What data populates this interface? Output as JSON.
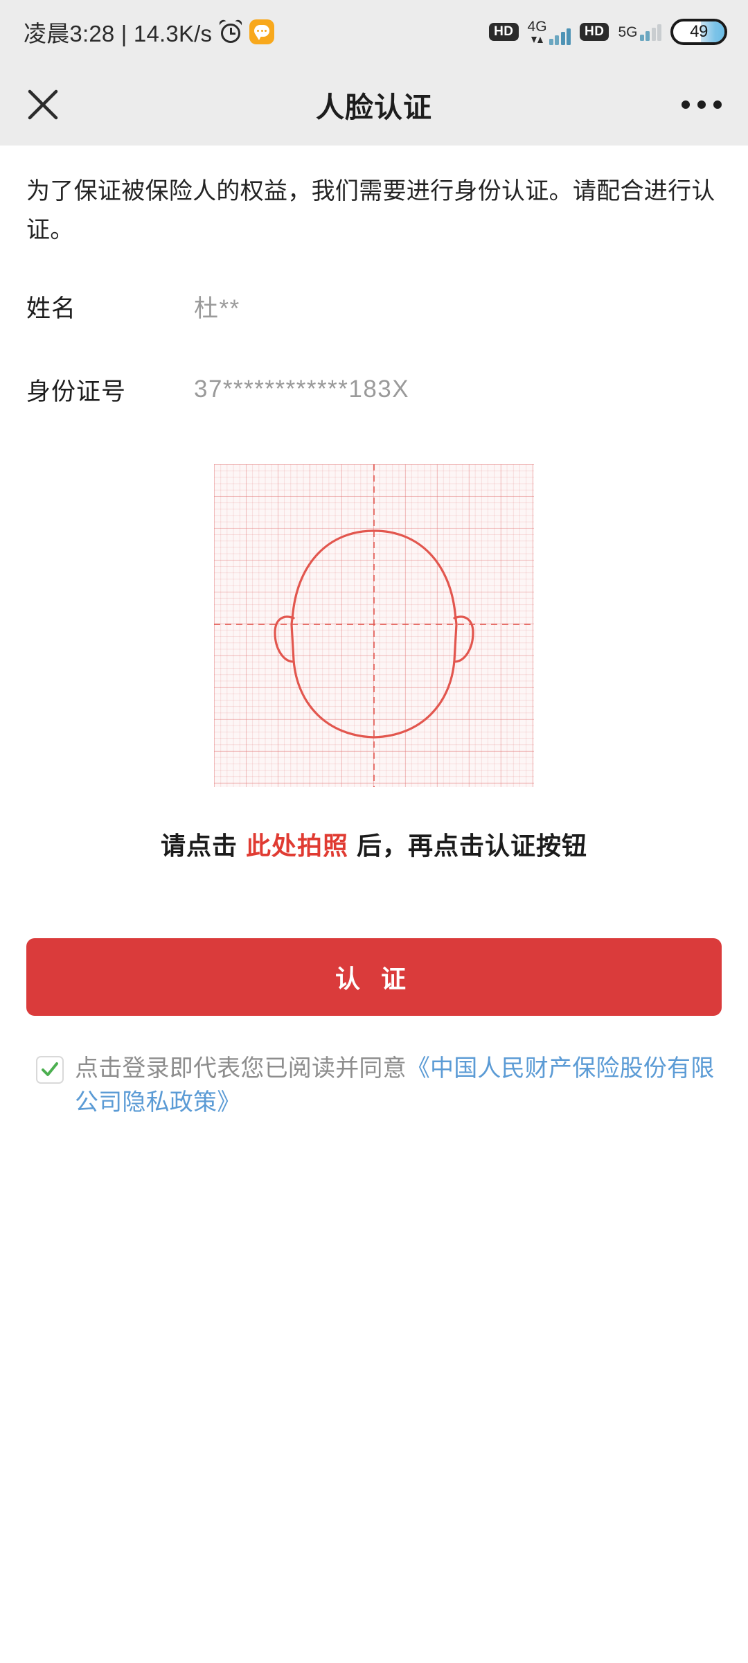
{
  "statusbar": {
    "clock": "凌晨3:28 | 14.3K/s",
    "alarm_icon": "alarm-clock-icon",
    "message_icon": "message-bubble-icon",
    "hd_badge_1": "HD",
    "network_1": "4G",
    "hd_badge_2": "HD",
    "network_2": "5G",
    "battery_level": "49"
  },
  "header": {
    "close_icon": "close-icon",
    "title": "人脸认证",
    "more_icon": "more-options-icon"
  },
  "main": {
    "description": "为了保证被保险人的权益，我们需要进行身份认证。请配合进行认证。",
    "fields": [
      {
        "label": "姓名",
        "value": "杜**"
      },
      {
        "label": "身份证号",
        "value": "37************183X"
      }
    ],
    "face_frame": {
      "name": "face-outline-guide",
      "outline_color": "#e2564e",
      "grid_color": "#e27878",
      "background": "#fdf6f6"
    },
    "hint": {
      "prefix": "请点击",
      "highlight": "此处拍照",
      "suffix": "后，再点击认证按钮",
      "highlight_color": "#e03b32"
    },
    "verify_button": {
      "label": "认 证",
      "color": "#da3b3b",
      "text_color": "#ffffff"
    },
    "agreement": {
      "checked": true,
      "check_color": "#4caf50",
      "text": "点击登录即代表您已阅读并同意",
      "link": "《中国人民财产保险股份有限公司隐私政策》",
      "link_color": "#5b9bd5"
    }
  }
}
